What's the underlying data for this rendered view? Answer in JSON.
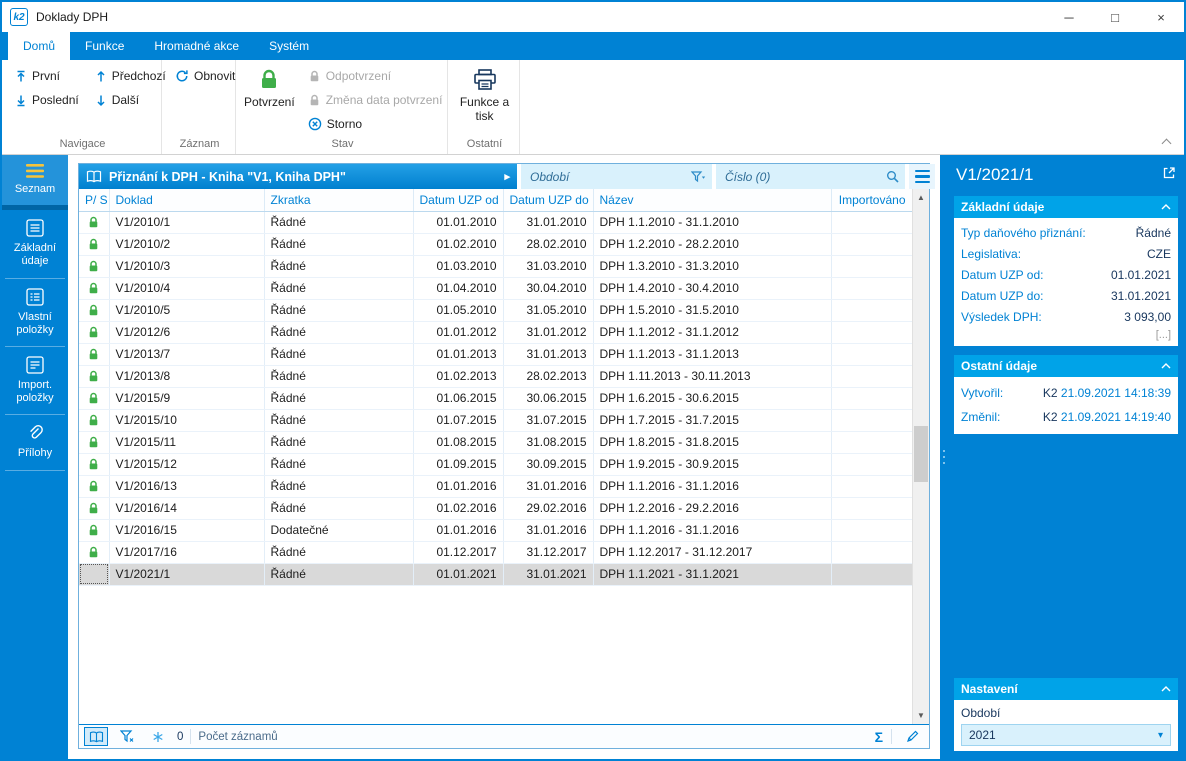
{
  "window": {
    "title": "Doklady DPH",
    "app_icon_text": "k2",
    "controls": {
      "minimize": "─",
      "maximize": "□",
      "close": "×"
    }
  },
  "icons": {
    "play": "▸",
    "chevron_down": "▾",
    "scroll_up": "▲",
    "scroll_down": "▼",
    "sigma": "Σ"
  },
  "ribbon": {
    "tabs": [
      {
        "label": "Domů",
        "active": true
      },
      {
        "label": "Funkce",
        "active": false
      },
      {
        "label": "Hromadné akce",
        "active": false
      },
      {
        "label": "Systém",
        "active": false
      }
    ],
    "groups": {
      "navigace": {
        "label": "Navigace",
        "first": "První",
        "last": "Poslední",
        "prev": "Předchozí",
        "next": "Další"
      },
      "zaznam": {
        "label": "Záznam",
        "refresh": "Obnovit"
      },
      "stav": {
        "label": "Stav",
        "confirm": "Potvrzení",
        "unconfirm": "Odpotvrzení",
        "change_date": "Změna data potvrzení",
        "cancel": "Storno"
      },
      "ostatni": {
        "label": "Ostatní",
        "functions_print": "Funkce a tisk"
      }
    }
  },
  "sidebar": {
    "items": [
      {
        "label": "Seznam",
        "active": true
      },
      {
        "label": "Základní údaje",
        "active": false
      },
      {
        "label": "Vlastní položky",
        "active": false
      },
      {
        "label": "Import. položky",
        "active": false
      },
      {
        "label": "Přílohy",
        "active": false
      }
    ]
  },
  "main": {
    "book_title": "Přiznání k DPH - Kniha \"V1, Kniha DPH\"",
    "filters": {
      "period_placeholder": "Období",
      "number_placeholder": "Číslo (0)"
    },
    "table": {
      "columns": [
        "P/ S",
        "Doklad",
        "Zkratka",
        "Datum UZP od",
        "Datum UZP do",
        "Název",
        "Importováno"
      ],
      "rows": [
        {
          "locked": true,
          "selected": false,
          "doklad": "V1/2010/1",
          "zkratka": "Řádné",
          "od": "01.01.2010",
          "do": "31.01.2010",
          "nazev": "DPH 1.1.2010 - 31.1.2010",
          "importovano": ""
        },
        {
          "locked": true,
          "selected": false,
          "doklad": "V1/2010/2",
          "zkratka": "Řádné",
          "od": "01.02.2010",
          "do": "28.02.2010",
          "nazev": "DPH 1.2.2010 - 28.2.2010",
          "importovano": ""
        },
        {
          "locked": true,
          "selected": false,
          "doklad": "V1/2010/3",
          "zkratka": "Řádné",
          "od": "01.03.2010",
          "do": "31.03.2010",
          "nazev": "DPH 1.3.2010 - 31.3.2010",
          "importovano": ""
        },
        {
          "locked": true,
          "selected": false,
          "doklad": "V1/2010/4",
          "zkratka": "Řádné",
          "od": "01.04.2010",
          "do": "30.04.2010",
          "nazev": "DPH 1.4.2010 - 30.4.2010",
          "importovano": ""
        },
        {
          "locked": true,
          "selected": false,
          "doklad": "V1/2010/5",
          "zkratka": "Řádné",
          "od": "01.05.2010",
          "do": "31.05.2010",
          "nazev": "DPH 1.5.2010 - 31.5.2010",
          "importovano": ""
        },
        {
          "locked": true,
          "selected": false,
          "doklad": "V1/2012/6",
          "zkratka": "Řádné",
          "od": "01.01.2012",
          "do": "31.01.2012",
          "nazev": "DPH 1.1.2012 - 31.1.2012",
          "importovano": ""
        },
        {
          "locked": true,
          "selected": false,
          "doklad": "V1/2013/7",
          "zkratka": "Řádné",
          "od": "01.01.2013",
          "do": "31.01.2013",
          "nazev": "DPH 1.1.2013 - 31.1.2013",
          "importovano": ""
        },
        {
          "locked": true,
          "selected": false,
          "doklad": "V1/2013/8",
          "zkratka": "Řádné",
          "od": "01.02.2013",
          "do": "28.02.2013",
          "nazev": "DPH 1.11.2013 - 30.11.2013",
          "importovano": ""
        },
        {
          "locked": true,
          "selected": false,
          "doklad": "V1/2015/9",
          "zkratka": "Řádné",
          "od": "01.06.2015",
          "do": "30.06.2015",
          "nazev": "DPH 1.6.2015 - 30.6.2015",
          "importovano": ""
        },
        {
          "locked": true,
          "selected": false,
          "doklad": "V1/2015/10",
          "zkratka": "Řádné",
          "od": "01.07.2015",
          "do": "31.07.2015",
          "nazev": "DPH 1.7.2015 - 31.7.2015",
          "importovano": ""
        },
        {
          "locked": true,
          "selected": false,
          "doklad": "V1/2015/11",
          "zkratka": "Řádné",
          "od": "01.08.2015",
          "do": "31.08.2015",
          "nazev": "DPH 1.8.2015 - 31.8.2015",
          "importovano": ""
        },
        {
          "locked": true,
          "selected": false,
          "doklad": "V1/2015/12",
          "zkratka": "Řádné",
          "od": "01.09.2015",
          "do": "30.09.2015",
          "nazev": "DPH 1.9.2015 - 30.9.2015",
          "importovano": ""
        },
        {
          "locked": true,
          "selected": false,
          "doklad": "V1/2016/13",
          "zkratka": "Řádné",
          "od": "01.01.2016",
          "do": "31.01.2016",
          "nazev": "DPH 1.1.2016 - 31.1.2016",
          "importovano": ""
        },
        {
          "locked": true,
          "selected": false,
          "doklad": "V1/2016/14",
          "zkratka": "Řádné",
          "od": "01.02.2016",
          "do": "29.02.2016",
          "nazev": "DPH 1.2.2016 - 29.2.2016",
          "importovano": ""
        },
        {
          "locked": true,
          "selected": false,
          "doklad": "V1/2016/15",
          "zkratka": "Dodatečné",
          "od": "01.01.2016",
          "do": "31.01.2016",
          "nazev": "DPH 1.1.2016 - 31.1.2016",
          "importovano": ""
        },
        {
          "locked": true,
          "selected": false,
          "doklad": "V1/2017/16",
          "zkratka": "Řádné",
          "od": "01.12.2017",
          "do": "31.12.2017",
          "nazev": "DPH 1.12.2017 - 31.12.2017",
          "importovano": ""
        },
        {
          "locked": false,
          "selected": true,
          "doklad": "V1/2021/1",
          "zkratka": "Řádné",
          "od": "01.01.2021",
          "do": "31.01.2021",
          "nazev": "DPH 1.1.2021 - 31.1.2021",
          "importovano": ""
        }
      ]
    },
    "statusbar": {
      "frozen_count": "0",
      "records_label": "Počet záznamů"
    }
  },
  "detail": {
    "title": "V1/2021/1",
    "basic": {
      "header": "Základní údaje",
      "fields": [
        {
          "label": "Typ daňového přiznání:",
          "value": "Řádné"
        },
        {
          "label": "Legislativa:",
          "value": "CZE"
        },
        {
          "label": "Datum UZP od:",
          "value": "01.01.2021"
        },
        {
          "label": "Datum UZP do:",
          "value": "31.01.2021"
        },
        {
          "label": "Výsledek DPH:",
          "value": "3 093,00"
        }
      ],
      "more_label": "[...]"
    },
    "other": {
      "header": "Ostatní údaje",
      "fields": [
        {
          "label": "Vytvořil:",
          "user": "K2",
          "timestamp": "21.09.2021 14:18:39"
        },
        {
          "label": "Změnil:",
          "user": "K2",
          "timestamp": "21.09.2021 14:19:40"
        }
      ]
    },
    "settings": {
      "header": "Nastavení",
      "period_label": "Období",
      "period_value": "2021"
    }
  },
  "colors": {
    "primary": "#0082d4",
    "section_header": "#00a3e8",
    "lock_green": "#3fae49",
    "field_bg": "#d9f1fc"
  }
}
